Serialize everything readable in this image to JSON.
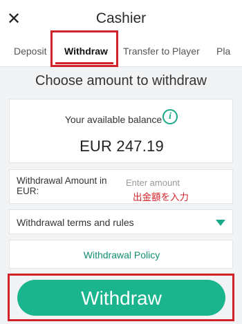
{
  "header": {
    "close_glyph": "✕",
    "title": "Cashier"
  },
  "tabs": [
    {
      "label": "Deposit",
      "active": false
    },
    {
      "label": "Withdraw",
      "active": true
    },
    {
      "label": "Transfer to Player",
      "active": false
    },
    {
      "label": "Pla",
      "active": false
    }
  ],
  "heading": "Choose amount to withdraw",
  "balance": {
    "label": "Your available balance",
    "info_glyph": "i",
    "value": "EUR 247.19"
  },
  "amount": {
    "label": "Withdrawal Amount in EUR:",
    "placeholder": "Enter amount",
    "value": "",
    "annotation": "出金額を入力"
  },
  "terms": {
    "label": "Withdrawal terms and rules"
  },
  "policy": {
    "label": "Withdrawal Policy"
  },
  "withdraw_button": {
    "label": "Withdraw"
  },
  "colors": {
    "accent": "#1bb58d",
    "accent_text": "#138f73",
    "highlight": "#d2232a",
    "background": "#f2f3f5"
  }
}
